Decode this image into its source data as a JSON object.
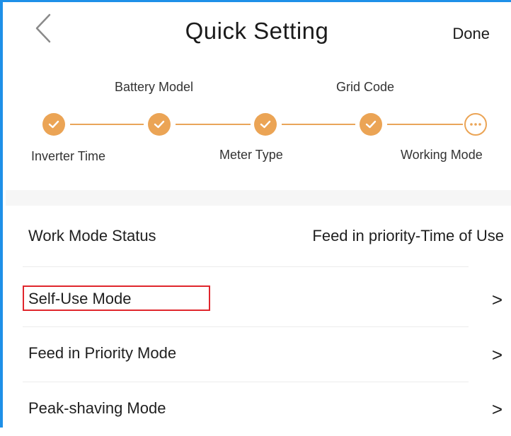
{
  "header": {
    "back_icon": "chevron-left-icon",
    "title": "Quick Setting",
    "done_label": "Done"
  },
  "stepper": {
    "accent_color": "#eba455",
    "steps": [
      {
        "label": "Inverter Time",
        "state": "completed",
        "icon": "check-icon"
      },
      {
        "label": "Battery Model",
        "state": "completed",
        "icon": "check-icon"
      },
      {
        "label": "Meter Type",
        "state": "completed",
        "icon": "check-icon"
      },
      {
        "label": "Grid Code",
        "state": "completed",
        "icon": "check-icon"
      },
      {
        "label": "Working Mode",
        "state": "current",
        "icon": "ellipsis-icon"
      }
    ]
  },
  "status_row": {
    "label": "Work Mode Status",
    "value": "Feed in priority-Time of Use"
  },
  "modes": [
    {
      "label": "Self-Use Mode",
      "chevron": ">",
      "highlighted": true
    },
    {
      "label": "Feed in Priority Mode",
      "chevron": ">"
    },
    {
      "label": "Peak-shaving Mode",
      "chevron": ">"
    }
  ],
  "colors": {
    "frame": "#1e90e8",
    "highlight": "#e0262d"
  }
}
